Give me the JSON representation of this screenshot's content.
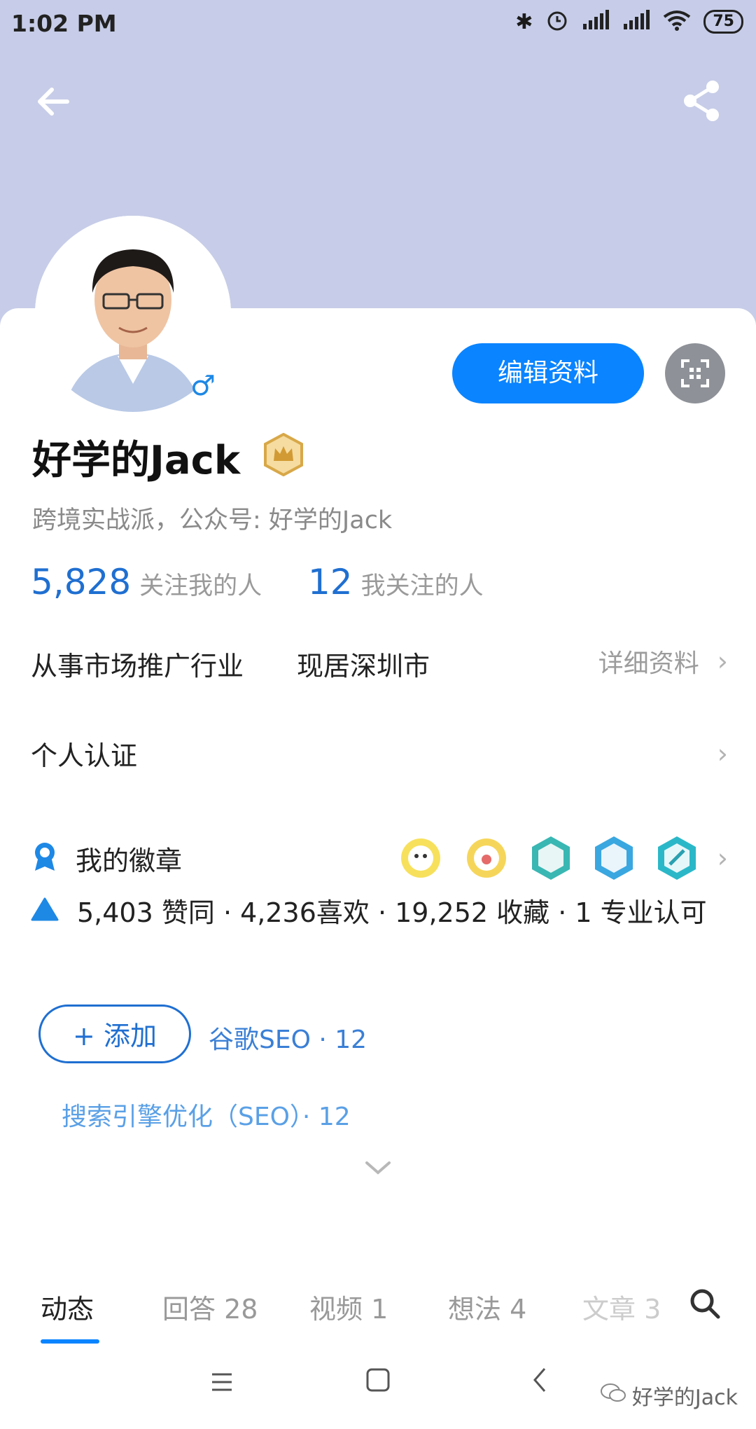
{
  "status": {
    "time": "1:02 PM",
    "battery": "75"
  },
  "profile": {
    "name": "好学的Jack",
    "bio": "跨境实战派，公众号: 好学的Jack",
    "edit_label": "编辑资料"
  },
  "stats": {
    "followers_count": "5,828",
    "followers_label": "关注我的人",
    "following_count": "12",
    "following_label": "我关注的人"
  },
  "info": {
    "industry": "从事市场推广行业",
    "location": "现居深圳市",
    "details_label": "详细资料"
  },
  "certification": {
    "label": "个人认证"
  },
  "badges": {
    "label": "我的徽章"
  },
  "achievements": {
    "text": "5,403 赞同 · 4,236喜欢 · 19,252 收藏 · 1 专业认可"
  },
  "tags": {
    "add_label": "添加",
    "items": [
      "谷歌SEO · 12",
      "搜索引擎优化（SEO）· 12"
    ]
  },
  "tabs": [
    {
      "label": "动态"
    },
    {
      "label": "回答 28"
    },
    {
      "label": "视频 1"
    },
    {
      "label": "想法 4"
    },
    {
      "label": "文章 3"
    }
  ],
  "watermark": "好学的Jack",
  "colors": {
    "accent": "#0a84ff",
    "header_bg": "#c7cde8"
  }
}
